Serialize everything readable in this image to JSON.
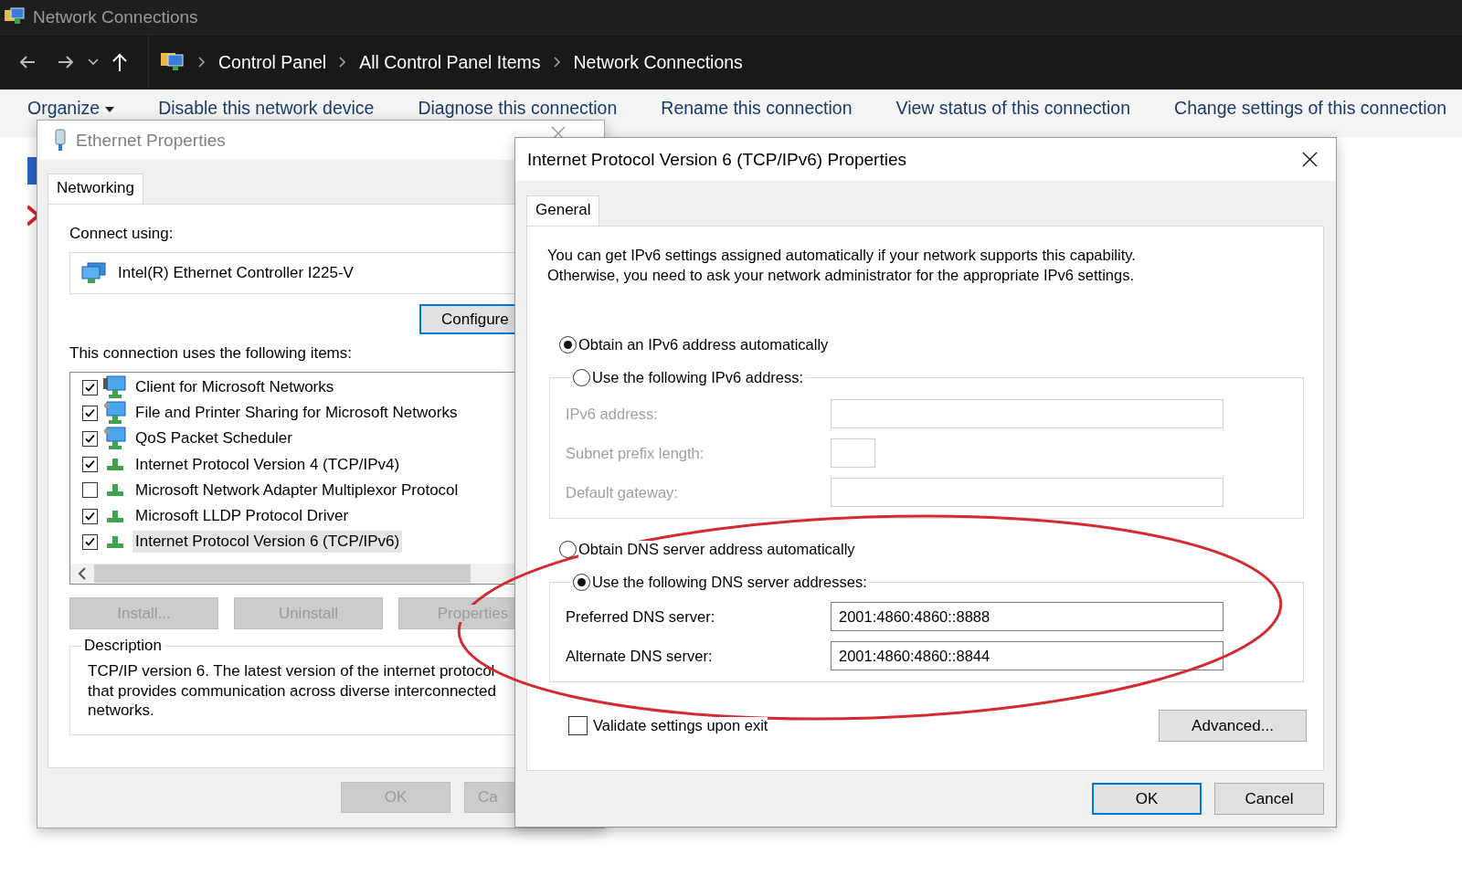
{
  "window": {
    "title": "Network Connections"
  },
  "address_bar": {
    "breadcrumbs": [
      "Control Panel",
      "All Control Panel Items",
      "Network Connections"
    ]
  },
  "toolbar": {
    "items": [
      {
        "label": "Organize",
        "dropdown": true
      },
      {
        "label": "Disable this network device",
        "dropdown": false
      },
      {
        "label": "Diagnose this connection",
        "dropdown": false
      },
      {
        "label": "Rename this connection",
        "dropdown": false
      },
      {
        "label": "View status of this connection",
        "dropdown": false
      },
      {
        "label": "Change settings of this connection",
        "dropdown": false
      }
    ]
  },
  "ethernet_dialog": {
    "title": "Ethernet Properties",
    "tabs": [
      {
        "label": "Networking",
        "selected": true
      }
    ],
    "connect_using_label": "Connect using:",
    "adapter": "Intel(R) Ethernet Controller I225-V",
    "configure_button": "Configure",
    "items_label": "This connection uses the following items:",
    "items": [
      {
        "label": "Client for Microsoft Networks",
        "checked": true,
        "kind": "client",
        "selected": false
      },
      {
        "label": "File and Printer Sharing for Microsoft Networks",
        "checked": true,
        "kind": "service",
        "selected": false
      },
      {
        "label": "QoS Packet Scheduler",
        "checked": true,
        "kind": "service",
        "selected": false
      },
      {
        "label": "Internet Protocol Version 4 (TCP/IPv4)",
        "checked": true,
        "kind": "protocol",
        "selected": false
      },
      {
        "label": "Microsoft Network Adapter Multiplexor Protocol",
        "checked": false,
        "kind": "protocol",
        "selected": false
      },
      {
        "label": "Microsoft LLDP Protocol Driver",
        "checked": true,
        "kind": "protocol",
        "selected": false
      },
      {
        "label": "Internet Protocol Version 6 (TCP/IPv6)",
        "checked": true,
        "kind": "protocol",
        "selected": true
      }
    ],
    "buttons": [
      {
        "label": "Install...",
        "disabled": true
      },
      {
        "label": "Uninstall",
        "disabled": true
      },
      {
        "label": "Properties",
        "disabled": true
      }
    ],
    "description": {
      "title": "Description",
      "lines": [
        "TCP/IP version 6. The latest version of the internet protocol",
        "that provides communication across diverse interconnected",
        "networks."
      ]
    },
    "footer_buttons": [
      {
        "label": "OK",
        "disabled": true
      },
      {
        "label": "Ca",
        "disabled": true
      }
    ]
  },
  "ipv6_dialog": {
    "title": "Internet Protocol Version 6 (TCP/IPv6) Properties",
    "tabs": [
      {
        "label": "General",
        "selected": true
      }
    ],
    "intro_lines": [
      "You can get IPv6 settings assigned automatically if your network supports this capability.",
      "Otherwise, you need to ask your network administrator for the appropriate IPv6 settings."
    ],
    "address_options": [
      {
        "label": "Obtain an IPv6 address automatically",
        "selected": true
      },
      {
        "label": "Use the following IPv6 address:",
        "selected": false
      }
    ],
    "address_fields": [
      {
        "label": "IPv6 address:",
        "disabled": true,
        "kind": "wide"
      },
      {
        "label": "Subnet prefix length:",
        "disabled": true,
        "kind": "short"
      },
      {
        "label": "Default gateway:",
        "disabled": true,
        "kind": "wide"
      }
    ],
    "dns_options": [
      {
        "label": "Obtain DNS server address automatically",
        "selected": false
      },
      {
        "label": "Use the following DNS server addresses:",
        "selected": true
      }
    ],
    "dns_fields": [
      {
        "label": "Preferred DNS server:",
        "value": "2001:4860:4860::8888",
        "disabled": false,
        "kind": "wide"
      },
      {
        "label": "Alternate DNS server:",
        "value": "2001:4860:4860::8844",
        "disabled": false,
        "kind": "wide"
      }
    ],
    "validate_checkbox": {
      "label": "Validate settings upon exit",
      "checked": false
    },
    "advanced_button": "Advanced...",
    "buttons": [
      {
        "label": "OK",
        "default": true
      },
      {
        "label": "Cancel",
        "default": false
      }
    ]
  }
}
